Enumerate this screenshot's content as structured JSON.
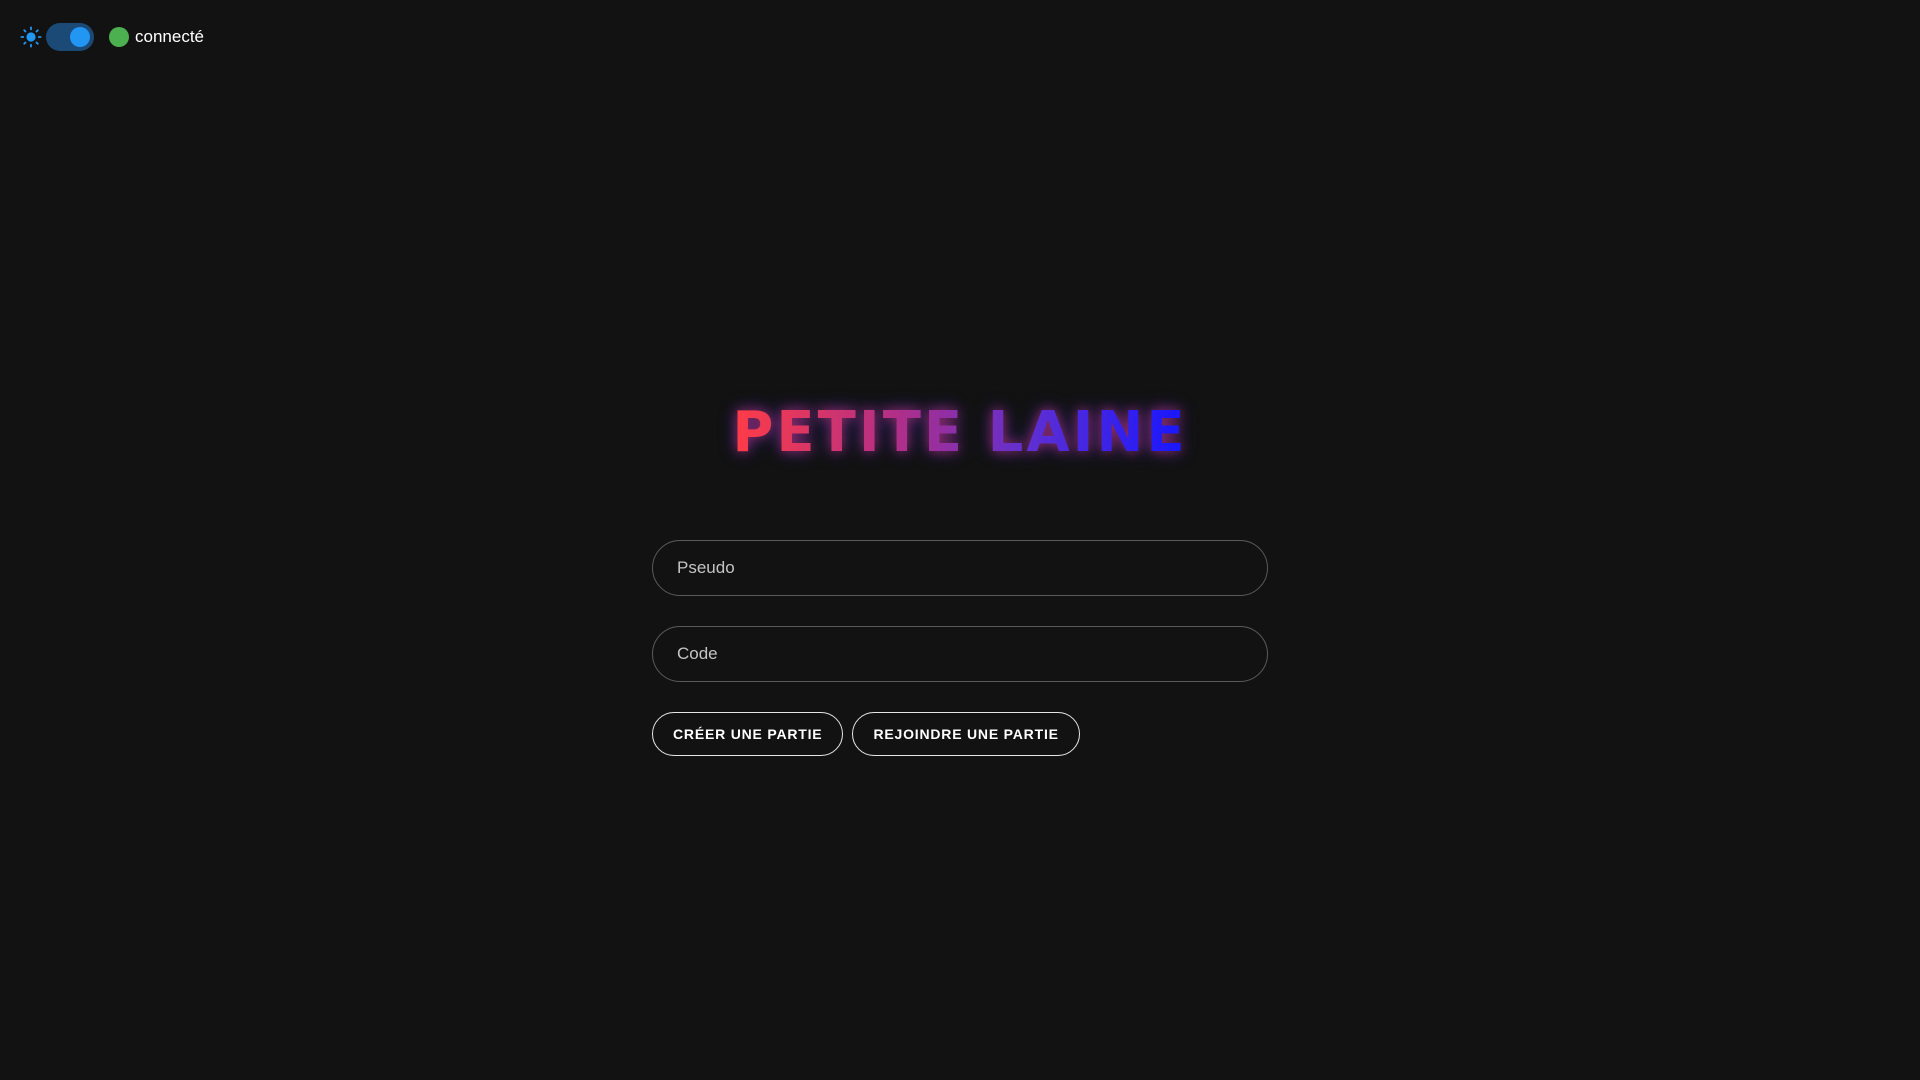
{
  "header": {
    "theme_toggle": {
      "icon": "sun-icon",
      "enabled": true,
      "accent": "#2196f3",
      "track": "#1c4a77"
    },
    "status": {
      "label": "connecté",
      "color": "#4caf50"
    }
  },
  "logo": {
    "title": "PETITE LAINE",
    "gradient": [
      "#ff3c46",
      "#b32f86",
      "#5f2fd1",
      "#1616ff"
    ]
  },
  "form": {
    "pseudo": {
      "placeholder": "Pseudo",
      "value": ""
    },
    "code": {
      "placeholder": "Code",
      "value": ""
    },
    "create_label": "CRÉER UNE PARTIE",
    "join_label": "REJOINDRE UNE PARTIE"
  }
}
